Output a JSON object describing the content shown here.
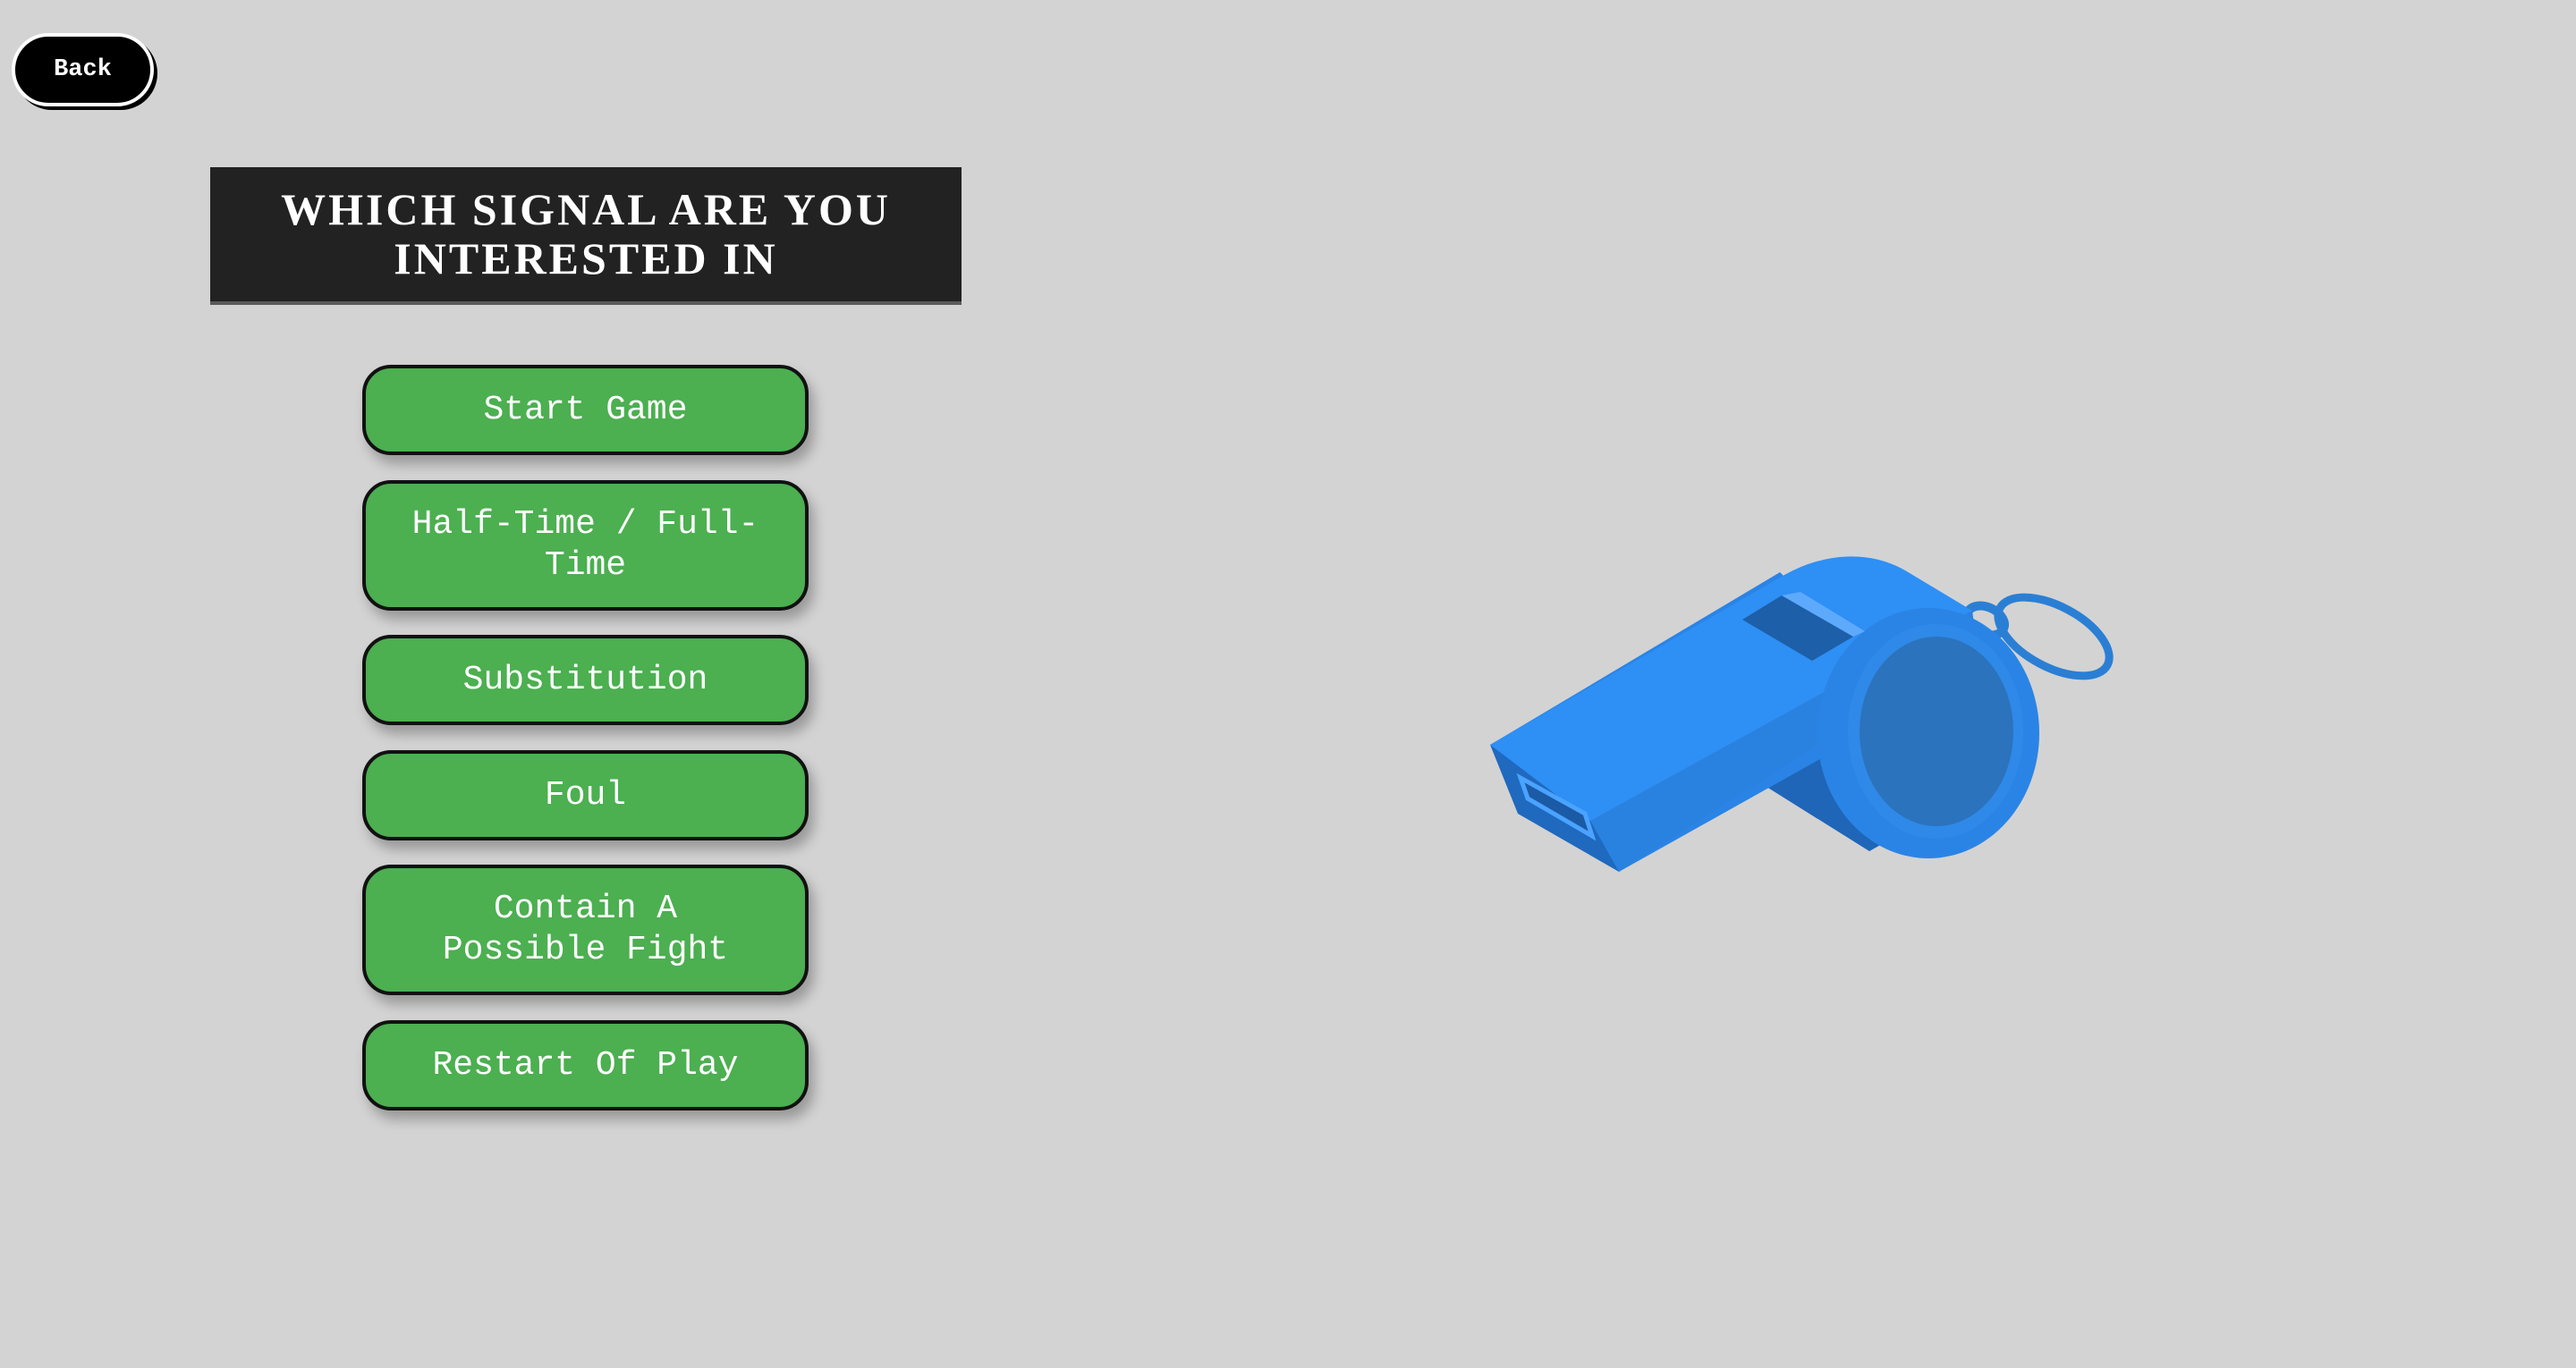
{
  "back": {
    "label": "Back"
  },
  "title": "WHICH SIGNAL ARE YOU INTERESTED IN",
  "menu": {
    "items": [
      {
        "label": "Start Game"
      },
      {
        "label": "Half-Time / Full-Time"
      },
      {
        "label": "Substitution"
      },
      {
        "label": "Foul"
      },
      {
        "label": "Contain A Possible Fight"
      },
      {
        "label": "Restart Of Play"
      }
    ]
  },
  "colors": {
    "background": "#d3d3d3",
    "title_bg": "#222222",
    "button_green": "#4caf50",
    "whistle_blue": "#2e8ff5"
  },
  "illustration": {
    "icon": "whistle-icon"
  }
}
